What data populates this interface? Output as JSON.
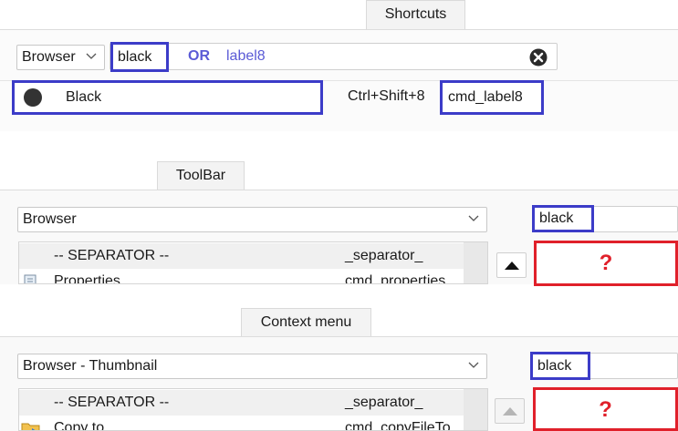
{
  "shortcuts": {
    "tab_label": "Shortcuts",
    "context_select": "Browser",
    "search_value": "black",
    "search_operator": "OR",
    "search_extra_term": "label8",
    "result": {
      "icon": "black-circle-icon",
      "name": "Black",
      "shortcut": "Ctrl+Shift+8",
      "command": "cmd_label8"
    }
  },
  "toolbar": {
    "tab_label": "ToolBar",
    "context_select": "Browser",
    "search_value": "black",
    "rows": [
      {
        "name": "-- SEPARATOR --",
        "command": "_separator_"
      },
      {
        "name": "Properties",
        "command": "cmd_properties"
      }
    ],
    "unknown_slot": "?"
  },
  "context_menu": {
    "tab_label": "Context menu",
    "context_select": "Browser - Thumbnail",
    "search_value": "black",
    "rows": [
      {
        "name": "-- SEPARATOR --",
        "command": "_separator_"
      },
      {
        "name": "Copy to...",
        "command": "cmd_copyFileTo"
      }
    ],
    "unknown_slot": "?"
  },
  "colors": {
    "annotation_blue": "#3c3cc8",
    "annotation_red": "#e0202a",
    "search_operator_blue": "#5b5bd6"
  }
}
